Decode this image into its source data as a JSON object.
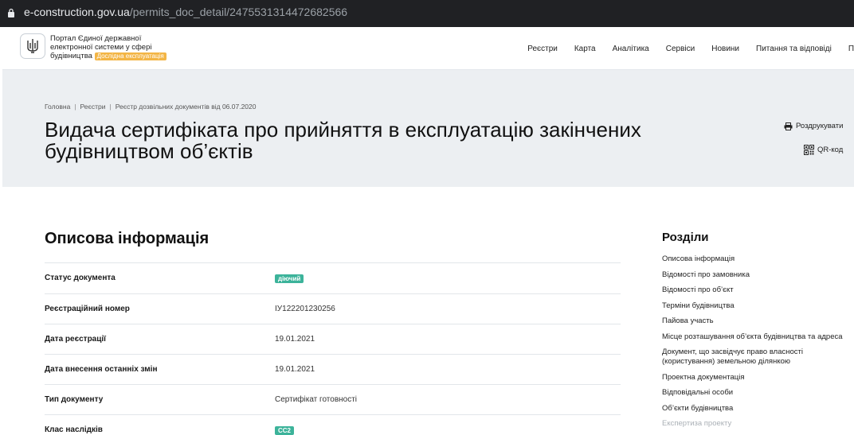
{
  "browser": {
    "url_domain": "e-construction.gov.ua",
    "url_path": "/permits_doc_detail/2475531314472682566"
  },
  "header": {
    "portal_line1": "Портал Єдиної державної",
    "portal_line2": "електронної системи у сфері",
    "portal_line3": "будівництва",
    "badge": "Дослідна експлуатація",
    "nav": [
      "Реєстри",
      "Карта",
      "Аналітика",
      "Сервіси",
      "Новини",
      "Питання та відповіді",
      "П"
    ]
  },
  "breadcrumb": [
    "Головна",
    "Реєстри",
    "Реєстр дозвільних документів від 06.07.2020"
  ],
  "page_title": "Видача сертифіката про прийняття в експлуатацію закінчених будівництвом об’єктів",
  "actions": {
    "print": "Роздрукувати",
    "qr": "QR-код"
  },
  "main": {
    "heading": "Описова інформація",
    "rows": [
      {
        "key": "Статус документа",
        "value": "діючий",
        "tag": true
      },
      {
        "key": "Реєстраційний номер",
        "value": "ІУ122201230256"
      },
      {
        "key": "Дата реєстрації",
        "value": "19.01.2021"
      },
      {
        "key": "Дата внесення останніх змін",
        "value": "19.01.2021"
      },
      {
        "key": "Тип документу",
        "value": "Сертифікат готовності"
      },
      {
        "key": "Клас наслідків",
        "value": "СС2",
        "tag": true
      }
    ]
  },
  "sections": {
    "heading": "Розділи",
    "items": [
      "Описова інформація",
      "Відомості про замовника",
      "Відомості про об’єкт",
      "Терміни будівництва",
      "Пайова участь",
      "Місце розташування об’єкта будівництва та адреса",
      "Документ, що засвідчує право власності (користування) земельною ділянкою",
      "Проектна документація",
      "Відповідальні особи",
      "Об’єкти будівництва",
      "Експертиза проекту"
    ]
  },
  "colors": {
    "status_tag": "#3cb39a",
    "badge": "#f3b545",
    "band": "#eceff2"
  }
}
